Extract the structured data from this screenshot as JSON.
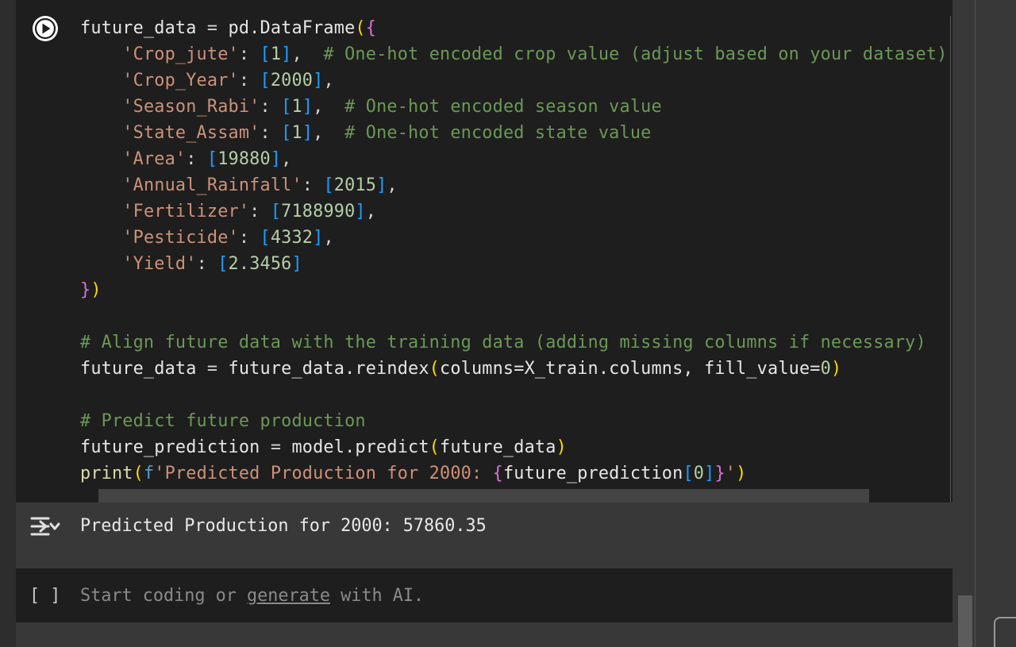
{
  "code_cell": {
    "run_icon": "play-circle-icon",
    "lines": [
      {
        "tokens": [
          [
            "var",
            "future_data"
          ],
          [
            "op",
            " = "
          ],
          [
            "var",
            "pd.DataFrame"
          ],
          [
            "b1",
            "("
          ],
          [
            "b2",
            "{"
          ]
        ]
      },
      {
        "tokens": [
          [
            "op",
            "    "
          ],
          [
            "str",
            "'Crop_jute'"
          ],
          [
            "op",
            ": "
          ],
          [
            "b3",
            "["
          ],
          [
            "num",
            "1"
          ],
          [
            "b3",
            "]"
          ],
          [
            "op",
            ",  "
          ],
          [
            "com",
            "# One-hot encoded crop value (adjust based on your dataset)"
          ]
        ]
      },
      {
        "tokens": [
          [
            "op",
            "    "
          ],
          [
            "str",
            "'Crop_Year'"
          ],
          [
            "op",
            ": "
          ],
          [
            "b3",
            "["
          ],
          [
            "num",
            "2000"
          ],
          [
            "b3",
            "]"
          ],
          [
            "op",
            ","
          ]
        ]
      },
      {
        "tokens": [
          [
            "op",
            "    "
          ],
          [
            "str",
            "'Season_Rabi'"
          ],
          [
            "op",
            ": "
          ],
          [
            "b3",
            "["
          ],
          [
            "num",
            "1"
          ],
          [
            "b3",
            "]"
          ],
          [
            "op",
            ",  "
          ],
          [
            "com",
            "# One-hot encoded season value"
          ]
        ]
      },
      {
        "tokens": [
          [
            "op",
            "    "
          ],
          [
            "str",
            "'State_Assam'"
          ],
          [
            "op",
            ": "
          ],
          [
            "b3",
            "["
          ],
          [
            "num",
            "1"
          ],
          [
            "b3",
            "]"
          ],
          [
            "op",
            ",  "
          ],
          [
            "com",
            "# One-hot encoded state value"
          ]
        ]
      },
      {
        "tokens": [
          [
            "op",
            "    "
          ],
          [
            "str",
            "'Area'"
          ],
          [
            "op",
            ": "
          ],
          [
            "b3",
            "["
          ],
          [
            "num",
            "19880"
          ],
          [
            "b3",
            "]"
          ],
          [
            "op",
            ","
          ]
        ]
      },
      {
        "tokens": [
          [
            "op",
            "    "
          ],
          [
            "str",
            "'Annual_Rainfall'"
          ],
          [
            "op",
            ": "
          ],
          [
            "b3",
            "["
          ],
          [
            "num",
            "2015"
          ],
          [
            "b3",
            "]"
          ],
          [
            "op",
            ","
          ]
        ]
      },
      {
        "tokens": [
          [
            "op",
            "    "
          ],
          [
            "str",
            "'Fertilizer'"
          ],
          [
            "op",
            ": "
          ],
          [
            "b3",
            "["
          ],
          [
            "num",
            "7188990"
          ],
          [
            "b3",
            "]"
          ],
          [
            "op",
            ","
          ]
        ]
      },
      {
        "tokens": [
          [
            "op",
            "    "
          ],
          [
            "str",
            "'Pesticide'"
          ],
          [
            "op",
            ": "
          ],
          [
            "b3",
            "["
          ],
          [
            "num",
            "4332"
          ],
          [
            "b3",
            "]"
          ],
          [
            "op",
            ","
          ]
        ]
      },
      {
        "tokens": [
          [
            "op",
            "    "
          ],
          [
            "str",
            "'Yield'"
          ],
          [
            "op",
            ": "
          ],
          [
            "b3",
            "["
          ],
          [
            "num",
            "2.3456"
          ],
          [
            "b3",
            "]"
          ]
        ]
      },
      {
        "tokens": [
          [
            "b2",
            "}"
          ],
          [
            "b1",
            ")"
          ]
        ]
      },
      {
        "tokens": []
      },
      {
        "tokens": [
          [
            "com",
            "# Align future data with the training data (adding missing columns if necessary)"
          ]
        ]
      },
      {
        "tokens": [
          [
            "var",
            "future_data"
          ],
          [
            "op",
            " = "
          ],
          [
            "var",
            "future_data.reindex"
          ],
          [
            "b1",
            "("
          ],
          [
            "var",
            "columns=X_train.columns, fill_value="
          ],
          [
            "num",
            "0"
          ],
          [
            "b1",
            ")"
          ]
        ]
      },
      {
        "tokens": []
      },
      {
        "tokens": [
          [
            "com",
            "# Predict future production"
          ]
        ]
      },
      {
        "tokens": [
          [
            "var",
            "future_prediction"
          ],
          [
            "op",
            " = "
          ],
          [
            "var",
            "model.predict"
          ],
          [
            "b1",
            "("
          ],
          [
            "var",
            "future_data"
          ],
          [
            "b1",
            ")"
          ]
        ]
      },
      {
        "tokens": [
          [
            "fn",
            "print"
          ],
          [
            "b1",
            "("
          ],
          [
            "kw",
            "f"
          ],
          [
            "str",
            "'Predicted Production for 2000: "
          ],
          [
            "b2",
            "{"
          ],
          [
            "var",
            "future_prediction"
          ],
          [
            "b3",
            "["
          ],
          [
            "num",
            "0"
          ],
          [
            "b3",
            "]"
          ],
          [
            "b2",
            "}"
          ],
          [
            "str",
            "'"
          ],
          [
            "b1",
            ")"
          ]
        ]
      }
    ]
  },
  "output": {
    "icon": "output-toggle-icon",
    "text": "Predicted Production for 2000: 57860.35"
  },
  "empty_cell": {
    "brackets": "[ ]",
    "placeholder_before": "Start coding or ",
    "placeholder_link": "generate",
    "placeholder_after": " with AI."
  }
}
